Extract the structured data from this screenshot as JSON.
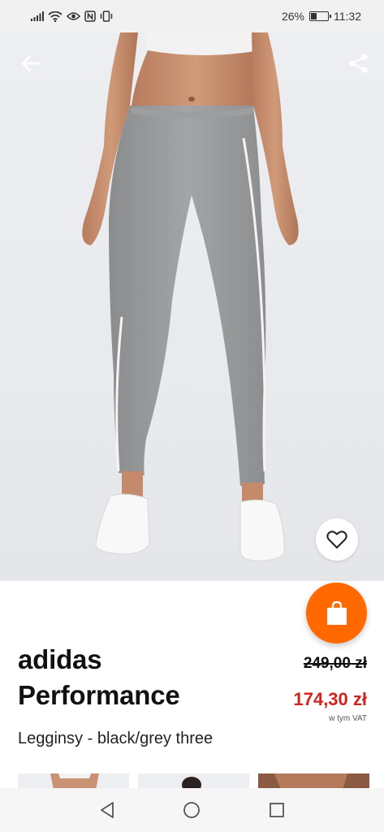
{
  "status_bar": {
    "battery_percent": "26%",
    "time": "11:32",
    "icons": [
      "signal-icon",
      "wifi-icon",
      "eye-icon",
      "nfc-icon",
      "vibrate-icon",
      "battery-icon"
    ]
  },
  "hero": {
    "back_icon": "arrow-left-icon",
    "share_icon": "share-icon",
    "favorite_icon": "heart-outline-icon"
  },
  "cart": {
    "icon": "shopping-bag-icon",
    "color": "#ff6900"
  },
  "product": {
    "brand_line1": "adidas",
    "brand_line2": "Performance",
    "old_price": "249,00 zł",
    "new_price": "174,30 zł",
    "vat_note": "w tym VAT",
    "subtitle": "Legginsy - black/grey three",
    "price_color": "#d2231f"
  },
  "thumbnails": [
    {
      "name": "thumbnail-1"
    },
    {
      "name": "thumbnail-2"
    },
    {
      "name": "thumbnail-3"
    }
  ],
  "nav_bar": {
    "back_icon": "triangle-back-icon",
    "home_icon": "circle-home-icon",
    "recents_icon": "square-recents-icon"
  }
}
